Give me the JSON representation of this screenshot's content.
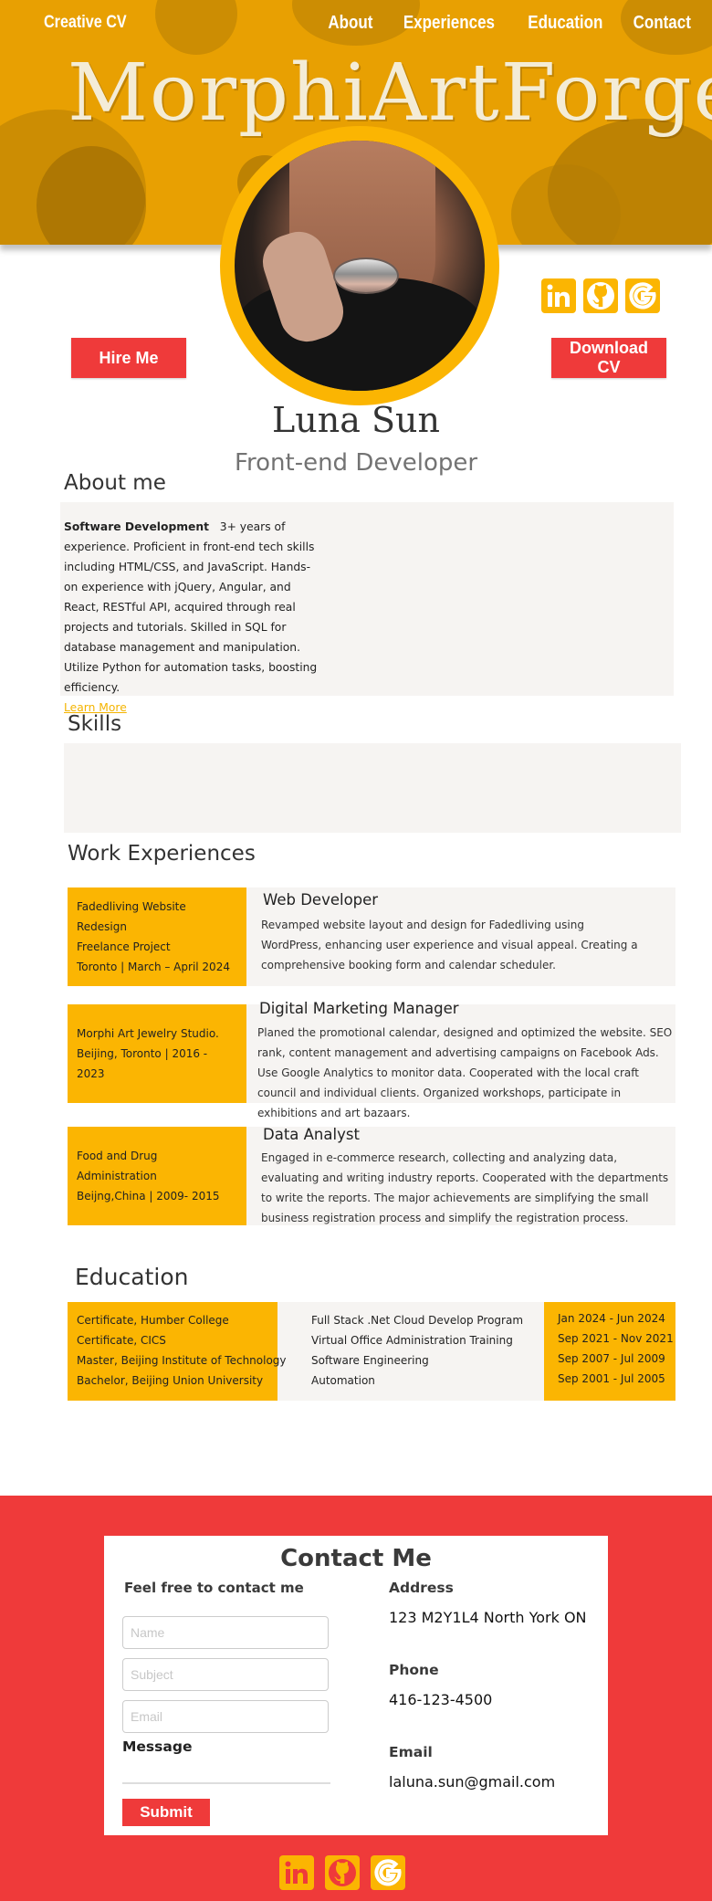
{
  "header": {
    "brand": "Creative CV",
    "nav": [
      "About",
      "Experiences",
      "Education",
      "Contact"
    ],
    "hero_title": "MorphiArtForge"
  },
  "social_icons": [
    "linkedin-icon",
    "github-icon",
    "google-icon"
  ],
  "buttons": {
    "hire": "Hire Me",
    "download": "Download CV"
  },
  "profile": {
    "name": "Luna Sun",
    "role": "Front-end Developer"
  },
  "about": {
    "heading": "About me",
    "lead": "Software Development",
    "text": "3+ years of experience. Proficient in front-end tech skills including HTML/CSS, and JavaScript. Hands-on experience with jQuery, Angular, and React, RESTful API, acquired through real projects and tutorials. Skilled in SQL for database management and manipulation. Utilize Python for automation tasks, boosting efficiency.",
    "learn_more": "Learn More"
  },
  "skills": {
    "heading": "Skills"
  },
  "experiences": {
    "heading": "Work Experiences",
    "items": [
      {
        "card": [
          "Fadedliving Website Redesign",
          "Freelance Project",
          "Toronto | March – April 2024"
        ],
        "title": "Web Developer",
        "desc": "Revamped website layout and design for Fadedliving using WordPress, enhancing user experience and visual appeal. Creating a comprehensive booking form and calendar scheduler."
      },
      {
        "card": [
          "Morphi Art Jewelry Studio.",
          "Beijing, Toronto | 2016 - 2023"
        ],
        "title": "Digital Marketing Manager",
        "desc": "Planed the promotional calendar, designed and optimized the website. SEO rank, content management and advertising campaigns on Facebook Ads. Use Google Analytics to monitor data. Cooperated with the local craft council and individual clients. Organized workshops, participate in exhibitions and art bazaars."
      },
      {
        "card": [
          "Food and Drug Administration",
          "Beijng,China | 2009- 2015"
        ],
        "title": "Data Analyst",
        "desc": "Engaged in e-commerce research, collecting and analyzing data, evaluating and writing industry reports. Cooperated with the departments to write the reports. The major achievements are simplifying the small business registration process and simplify the registration process."
      }
    ]
  },
  "education": {
    "heading": "Education",
    "degrees": [
      "Certificate, Humber College",
      "Certificate, CICS",
      "Master, Beijing Institute of Technology",
      "Bachelor, Beijing Union University"
    ],
    "programs": [
      "Full Stack .Net Cloud Develop Program",
      "Virtual Office Administration Training",
      "Software Engineering",
      "Automation"
    ],
    "dates": [
      "Jan 2024 - Jun 2024",
      "Sep 2021 - Nov 2021",
      "Sep 2007 - Jul  2009",
      "Sep 2001 - Jul 2005"
    ]
  },
  "contact": {
    "title": "Contact Me",
    "subtitle": "Feel free to contact me",
    "placeholders": {
      "name": "Name",
      "subject": "Subject",
      "email": "Email"
    },
    "message_label": "Message",
    "submit": "Submit",
    "address_label": "Address",
    "address": "123 M2Y1L4 North York ON",
    "phone_label": "Phone",
    "phone": "416-123-4500",
    "email_label": "Email",
    "email": "laluna.sun@gmail.com"
  },
  "colors": {
    "accent": "#fbb502",
    "hero": "#e8a002",
    "red": "#ef3a3a",
    "panel": "#f6f4f2"
  }
}
